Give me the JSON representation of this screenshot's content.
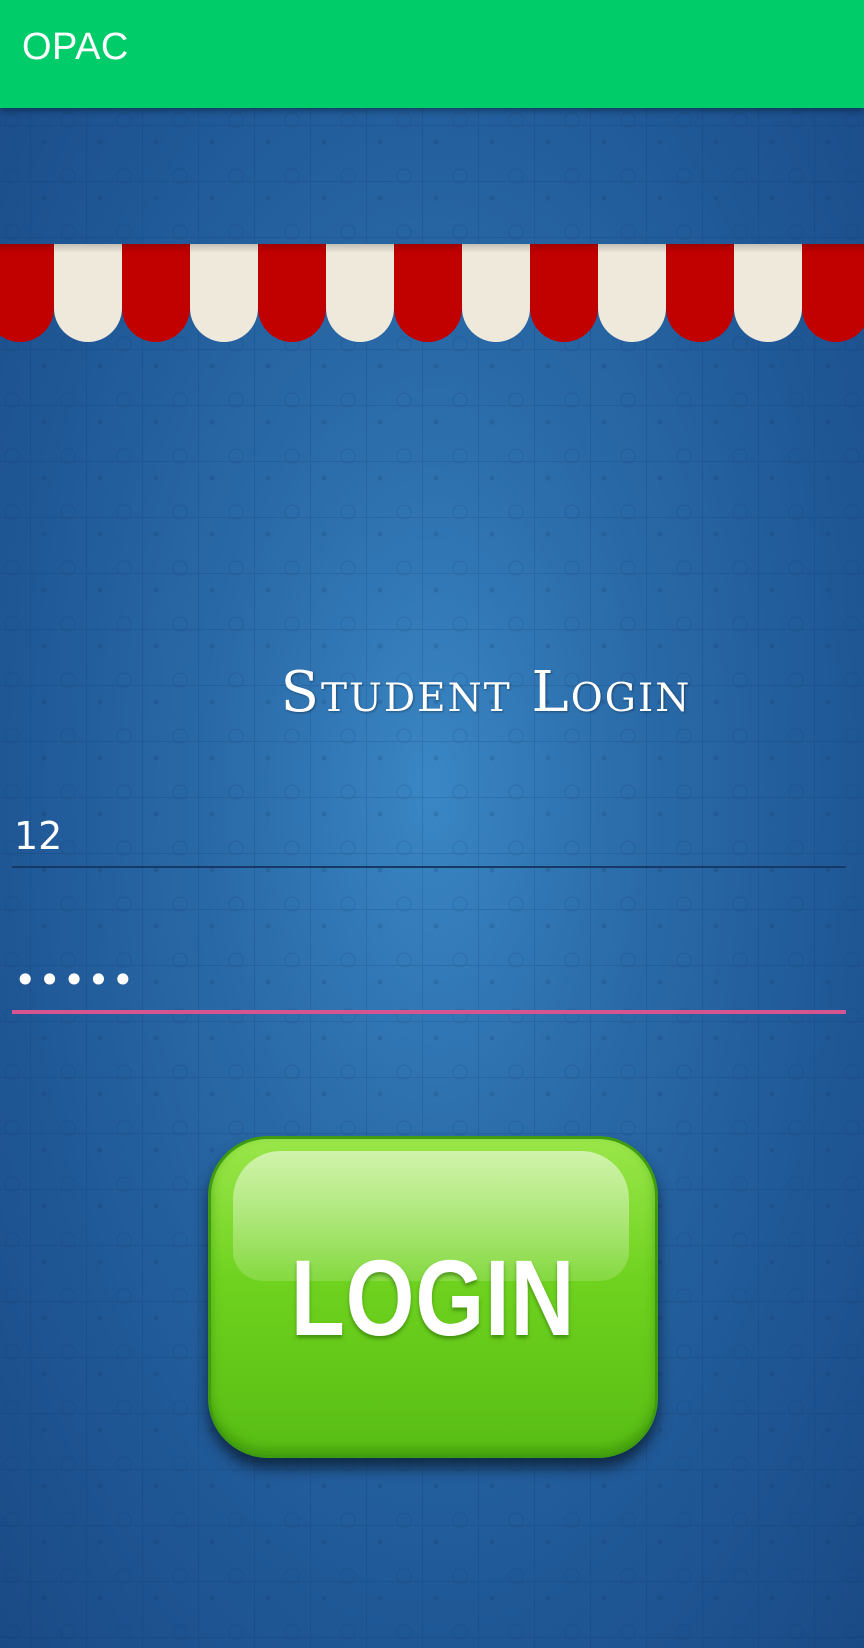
{
  "app": {
    "title": "OPAC"
  },
  "login": {
    "heading": "Student Login",
    "username_value": "12",
    "password_value": "•••••",
    "button_label": "LOGIN"
  },
  "colors": {
    "appbar": "#00cc6a",
    "background": "#2a6aa8",
    "awning_red": "#c10000",
    "awning_cream": "#efe9dc",
    "button_green": "#6fd21f",
    "focus_underline": "#d6548f"
  }
}
